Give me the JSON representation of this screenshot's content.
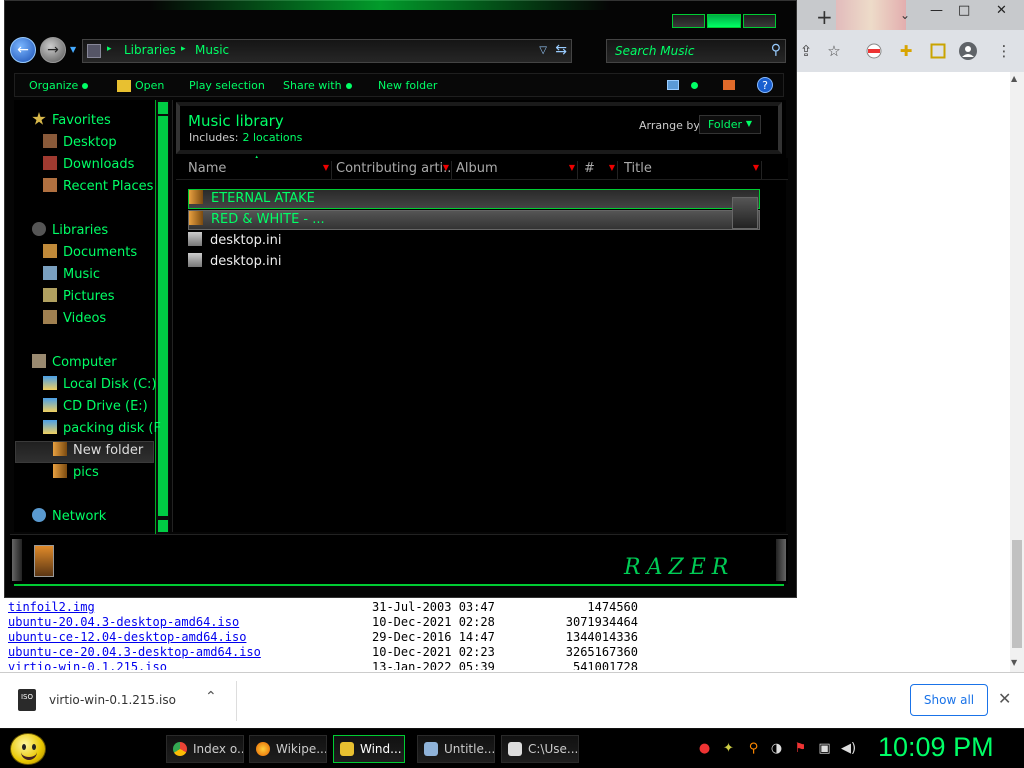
{
  "browser": {
    "new_tab": "+",
    "tab_dropdown": "⌄",
    "window_buttons": {
      "minimize": "—",
      "maximize": "□",
      "close": "✕"
    }
  },
  "explorer": {
    "address": {
      "crumbs": [
        "Libraries",
        "Music"
      ]
    },
    "search_placeholder": "Search Music",
    "commands": {
      "organize": "Organize",
      "open": "Open",
      "play_selection": "Play selection",
      "share_with": "Share with",
      "new_folder": "New folder",
      "help": "?"
    },
    "nav": {
      "favorites": "Favorites",
      "desktop": "Desktop",
      "downloads": "Downloads",
      "recent_places": "Recent Places",
      "libraries": "Libraries",
      "documents": "Documents",
      "music": "Music",
      "pictures": "Pictures",
      "videos": "Videos",
      "computer": "Computer",
      "local_disk": "Local Disk (C:)",
      "cd_drive": "CD Drive (E:)",
      "packing_disk": "packing disk (F",
      "new_folder": "New folder",
      "pics": "pics",
      "network": "Network"
    },
    "library": {
      "title": "Music library",
      "includes_label": "Includes:",
      "includes_link": "2 locations",
      "arrange_label": "Arrange by:",
      "arrange_value": "Folder"
    },
    "columns": [
      "Name",
      "Contributing arti...",
      "Album",
      "#",
      "Title"
    ],
    "files": [
      {
        "name": "ETERNAL ATAKE",
        "type": "folder"
      },
      {
        "name": "RED & WHITE - ...",
        "type": "folder"
      },
      {
        "name": "desktop.ini",
        "type": "file"
      },
      {
        "name": "desktop.ini",
        "type": "file"
      }
    ],
    "brand_logo": "RAZER"
  },
  "listing": [
    {
      "name": "tinfoil2.img",
      "date": "31-Jul-2003 03:47",
      "size": "1474560"
    },
    {
      "name": "ubuntu-20.04.3-desktop-amd64.iso",
      "date": "10-Dec-2021 02:28",
      "size": "3071934464"
    },
    {
      "name": "ubuntu-ce-12.04-desktop-amd64.iso",
      "date": "29-Dec-2016 14:47",
      "size": "1344014336"
    },
    {
      "name": "ubuntu-ce-20.04.3-desktop-amd64.iso",
      "date": "10-Dec-2021 02:23",
      "size": "3265167360"
    },
    {
      "name": "virtio-win-0.1.215.iso",
      "date": "13-Jan-2022 05:39",
      "size": "541001728"
    }
  ],
  "downloads_bar": {
    "file_name": "virtio-win-0.1.215.iso",
    "file_icon_text": "ISO",
    "show_all": "Show all",
    "close": "✕"
  },
  "taskbar": {
    "tasks": [
      {
        "label": "Index o...",
        "icon_color": "#4285f4"
      },
      {
        "label": "Wikipe...",
        "icon_color": "#e66000"
      },
      {
        "label": "Wind...",
        "icon_color": "#e8c030"
      },
      {
        "label": "Untitle...",
        "icon_color": "#8fb3d9"
      },
      {
        "label": "C:\\Use...",
        "icon_color": "#dddddd"
      }
    ],
    "clock": "10:09 PM"
  },
  "colors": {
    "accent_green": "#00ff66",
    "window_bg": "#050505",
    "link_blue": "#0000ee",
    "chrome_blue": "#1a73e8"
  }
}
